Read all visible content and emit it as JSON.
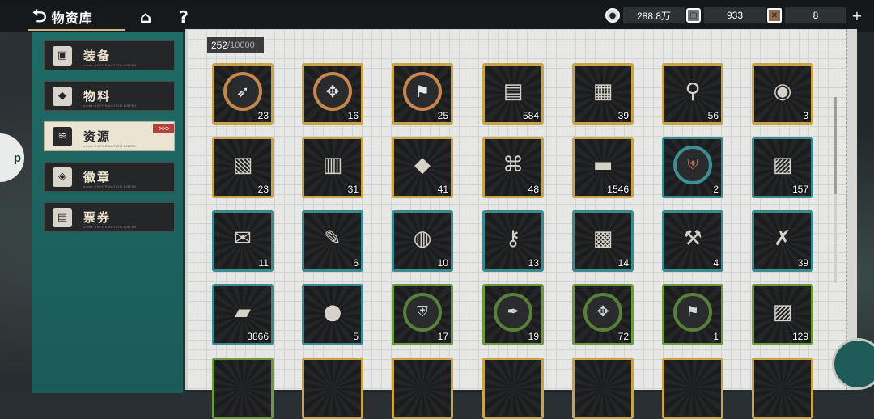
{
  "header": {
    "title": "物资库",
    "back_glyph": "⮌",
    "home_glyph": "⌂",
    "help_glyph": "?"
  },
  "currencies": [
    {
      "icon": "coin-icon",
      "value": "288.8万",
      "plus": "+"
    },
    {
      "icon": "ticket-icon",
      "value": "933",
      "plus": "+"
    },
    {
      "icon": "crate-icon",
      "value": "8",
      "plus": "+"
    }
  ],
  "categories": [
    {
      "label": "装备",
      "icon": "equipment-icon",
      "glyph": "▣",
      "sub": "name: INFORMATION ENTRY",
      "active": false
    },
    {
      "label": "物料",
      "icon": "materials-icon",
      "glyph": "◆",
      "sub": "name: INFORMATION ENTRY",
      "active": false
    },
    {
      "label": "资源",
      "icon": "resources-icon",
      "glyph": "≋",
      "sub": "name: INFORMATION ENTRY",
      "active": true
    },
    {
      "label": "徽章",
      "icon": "badge-icon",
      "glyph": "◈",
      "sub": "name: INFORMATION ENTRY",
      "active": false
    },
    {
      "label": "票券",
      "icon": "voucher-icon",
      "glyph": "▤",
      "sub": "name: INFORMATION ENTRY",
      "active": false
    }
  ],
  "active_arrows": ">>>",
  "storage": {
    "current": "252",
    "separator": "/",
    "max": "10000"
  },
  "items": [
    {
      "count": "23",
      "rarity": "gold",
      "icon": "bow-medal-icon"
    },
    {
      "count": "16",
      "rarity": "gold",
      "icon": "knot-medal-icon"
    },
    {
      "count": "25",
      "rarity": "gold",
      "icon": "flag-medal-icon"
    },
    {
      "count": "584",
      "rarity": "gold",
      "icon": "book-stack-icon"
    },
    {
      "count": "39",
      "rarity": "gold",
      "icon": "paint-set-icon"
    },
    {
      "count": "56",
      "rarity": "gold",
      "icon": "broom-icon"
    },
    {
      "count": "3",
      "rarity": "gold",
      "icon": "green-pot-icon"
    },
    {
      "count": "23",
      "rarity": "gold",
      "icon": "papers-icon"
    },
    {
      "count": "31",
      "rarity": "gold",
      "icon": "box-pile-icon"
    },
    {
      "count": "41",
      "rarity": "gold",
      "icon": "crystal-cube-icon"
    },
    {
      "count": "48",
      "rarity": "gold",
      "icon": "metal-frame-icon"
    },
    {
      "count": "1546",
      "rarity": "gold",
      "icon": "ingots-icon"
    },
    {
      "count": "2",
      "rarity": "teal",
      "icon": "shield-ring-icon"
    },
    {
      "count": "157",
      "rarity": "teal",
      "icon": "document-pack-icon"
    },
    {
      "count": "11",
      "rarity": "teal",
      "icon": "talisman-icon"
    },
    {
      "count": "6",
      "rarity": "teal",
      "icon": "brushes-icon"
    },
    {
      "count": "10",
      "rarity": "teal",
      "icon": "jar-icon"
    },
    {
      "count": "13",
      "rarity": "teal",
      "icon": "tube-icon"
    },
    {
      "count": "14",
      "rarity": "teal",
      "icon": "bag-icon"
    },
    {
      "count": "4",
      "rarity": "teal",
      "icon": "tools-icon"
    },
    {
      "count": "39",
      "rarity": "teal",
      "icon": "crossbow-icon"
    },
    {
      "count": "3866",
      "rarity": "teal",
      "icon": "silver-block-icon"
    },
    {
      "count": "5",
      "rarity": "teal",
      "icon": "cookies-icon"
    },
    {
      "count": "17",
      "rarity": "green",
      "icon": "shield-ring-icon"
    },
    {
      "count": "19",
      "rarity": "green",
      "icon": "feather-ring-icon"
    },
    {
      "count": "72",
      "rarity": "green",
      "icon": "knot-ring-icon"
    },
    {
      "count": "1",
      "rarity": "green",
      "icon": "flag-ring-icon"
    },
    {
      "count": "129",
      "rarity": "green",
      "icon": "document-pack-icon"
    }
  ]
}
